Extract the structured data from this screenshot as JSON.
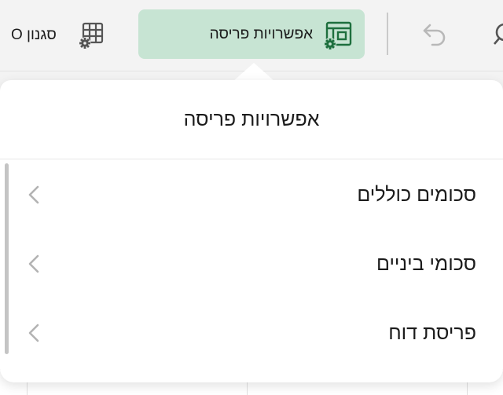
{
  "toolbar": {
    "style_button_label": "סגנון O",
    "layout_button_label": "אפשרויות פריסה",
    "accent_color": "#c7e4d3",
    "icon_color": "#1e6f3e"
  },
  "popover": {
    "title": "אפשרויות פריסה",
    "items": [
      {
        "label": "סכומים כוללים"
      },
      {
        "label": "סכומי ביניים"
      },
      {
        "label": "פריסת דוח"
      }
    ]
  }
}
